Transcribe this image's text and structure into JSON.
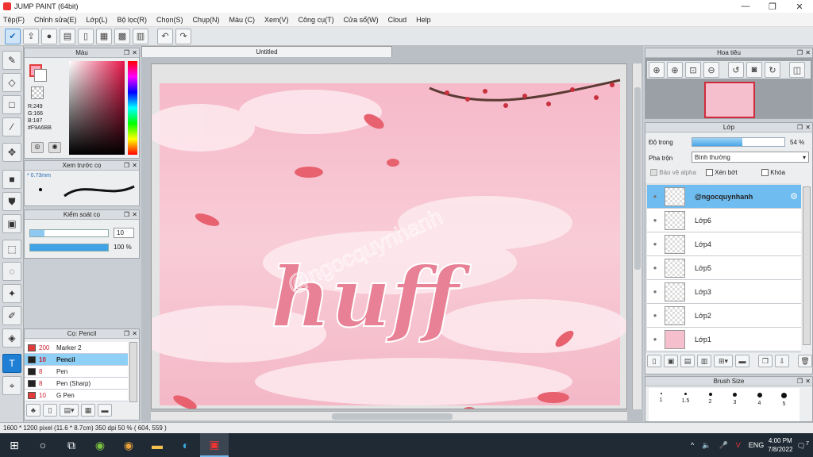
{
  "window": {
    "title": "JUMP PAINT (64bit)"
  },
  "menu": [
    "Tệp(F)",
    "Chỉnh sửa(E)",
    "Lớp(L)",
    "Bộ lọc(R)",
    "Chọn(S)",
    "Chụp(N)",
    "Màu (C)",
    "Xem(V)",
    "Công cụ(T)",
    "Cửa sổ(W)",
    "Cloud",
    "Help"
  ],
  "color_panel": {
    "title": "Màu",
    "r": "R:249",
    "g": "G:166",
    "b": "B:187",
    "hex": "#F9A6BB",
    "foreground": "#F9A6BB",
    "background": "#FFFFFF"
  },
  "brush_preview": {
    "title": "Xem trước cọ",
    "size": "0.73mm"
  },
  "brush_control": {
    "title": "Kiểm soát cọ",
    "size": "10",
    "opacity": "100 %",
    "opacity_fraction": 1.0
  },
  "brush_list": {
    "title": "Cọ: Pencil",
    "items": [
      {
        "size": "200",
        "name": "Marker 2",
        "color": "#e23b3b"
      },
      {
        "size": "10",
        "name": "Pencil",
        "color": "#222222",
        "selected": true
      },
      {
        "size": "8",
        "name": "Pen",
        "color": "#222222"
      },
      {
        "size": "8",
        "name": "Pen (Sharp)",
        "color": "#222222"
      },
      {
        "size": "10",
        "name": "G Pen",
        "color": "#e23b3b"
      }
    ]
  },
  "document": {
    "tab": "Untitled"
  },
  "artwork": {
    "main_text": "huff",
    "watermark": "@ngocquynhanh"
  },
  "navigator": {
    "title": "Hoa tiêu"
  },
  "layers": {
    "title": "Lớp",
    "opacity_label": "Độ trong",
    "opacity_value": "54 %",
    "opacity_fraction": 0.54,
    "blend_label": "Pha trộn",
    "blend_value": "Bình thường",
    "protect_alpha": "Bảo vệ alpha",
    "clipping": "Xén bớt",
    "lock": "Khóa",
    "items": [
      {
        "name": "@ngocquynhanh",
        "selected": true
      },
      {
        "name": "Lớp6"
      },
      {
        "name": "Lớp4"
      },
      {
        "name": "Lớp5"
      },
      {
        "name": "Lớp3"
      },
      {
        "name": "Lớp2"
      },
      {
        "name": "Lớp1"
      }
    ]
  },
  "brush_size_panel": {
    "title": "Brush Size",
    "labels": [
      "1",
      "1.5",
      "2",
      "3",
      "4",
      "5"
    ]
  },
  "status": {
    "text": "1600 * 1200 pixel   (11.6 * 8.7cm)   350 dpi   50 %   ( 604, 559 )"
  },
  "taskbar": {
    "lang": "ENG",
    "time": "4:00 PM",
    "date": "7/8/2022",
    "notifications": "7"
  },
  "colors": {
    "accent": "#1e7fd4",
    "layer_selected": "#6fbcf0",
    "canvas_pink": "#f7c6d2"
  }
}
